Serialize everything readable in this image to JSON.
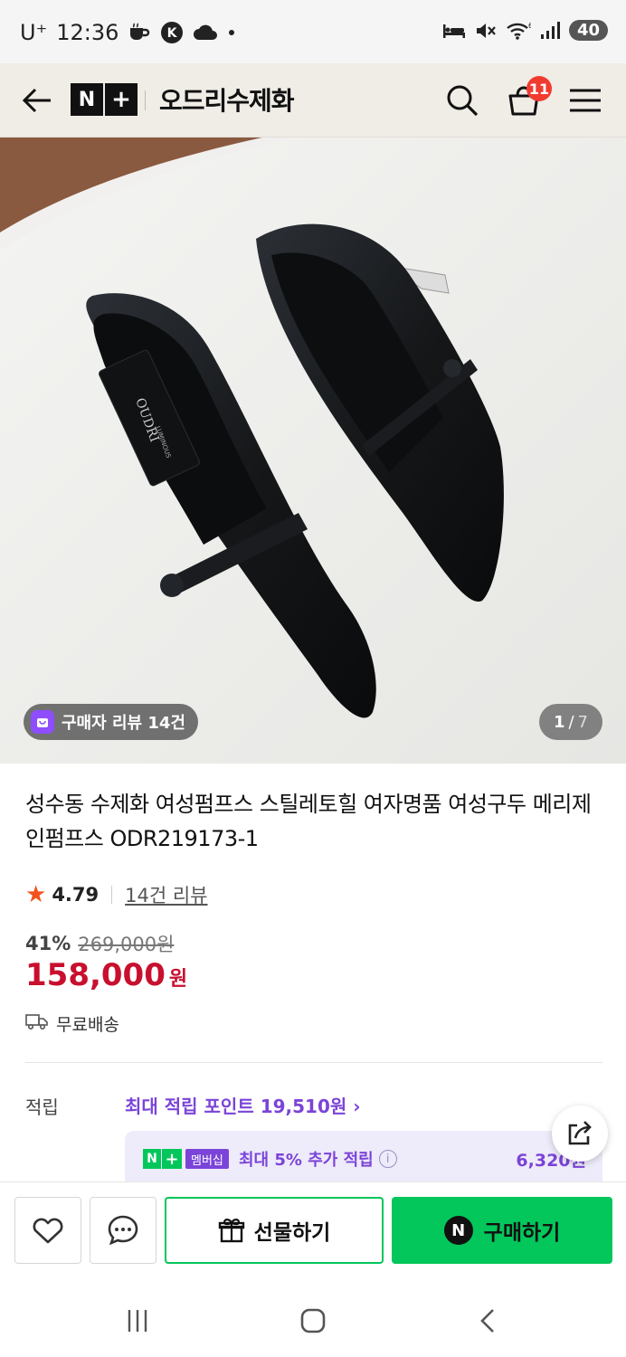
{
  "status_bar": {
    "carrier": "U⁺",
    "time": "12:36",
    "battery": "40",
    "left_icons": [
      "coffee-icon",
      "kakao-icon",
      "cloud-icon",
      "dot-icon"
    ],
    "right_icons": [
      "bed-icon",
      "mute-icon",
      "wifi-icon",
      "signal-icon"
    ]
  },
  "header": {
    "logo_n": "N",
    "logo_plus": "+",
    "store_name": "오드리수제화",
    "cart_count": "11",
    "icons": [
      "back-arrow-icon",
      "search-icon",
      "cart-icon",
      "menu-icon"
    ]
  },
  "gallery": {
    "review_badge": "구매자 리뷰 14건",
    "current_page": "1",
    "page_sep": "/",
    "total_pages": "7",
    "insole_brand": "OUDRI",
    "insole_sub": "LUMINOUS"
  },
  "product": {
    "title": "성수동 수제화 여성펌프스 스틸레토힐 여자명품 여성구두 메리제인펌프스 ODR219173-1",
    "rating": "4.79",
    "review_count": "14건 리뷰",
    "discount": "41%",
    "original_price": "269,000원",
    "price": "158,000",
    "currency": "원",
    "shipping": "무료배송"
  },
  "points": {
    "label": "적립",
    "max_points": "최대 적립 포인트 19,510원",
    "member_badge_n": "N",
    "member_badge_plus": "+",
    "member_badge_text": "멤버십",
    "member_text": "최대 5% 추가 적립",
    "info": "i",
    "member_amount": "6,320원"
  },
  "actions": {
    "gift": "선물하기",
    "buy": "구매하기",
    "buy_logo": "N"
  },
  "colors": {
    "naver_green": "#03c75a",
    "price_red": "#c8102e",
    "member_purple": "#7b44d8"
  }
}
